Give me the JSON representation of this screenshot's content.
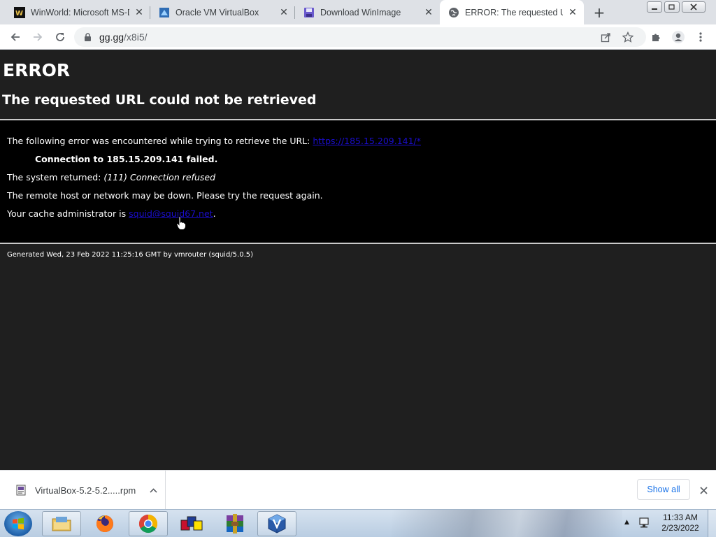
{
  "browser": {
    "tabs": [
      {
        "title": "WinWorld: Microsoft MS-D",
        "icon": "winworld-icon",
        "active": false
      },
      {
        "title": "Oracle VM VirtualBox",
        "icon": "virtualbox-icon",
        "active": false
      },
      {
        "title": "Download WinImage",
        "icon": "floppy-disk-icon",
        "active": false
      },
      {
        "title": "ERROR: The requested URL",
        "icon": "globe-icon",
        "active": true
      }
    ],
    "new_tab_label": "+",
    "address_bar": {
      "host": "gg.gg",
      "path": "/x8i5/"
    }
  },
  "page": {
    "heading": "ERROR",
    "subheading": "The requested URL could not be retrieved",
    "error_intro": "The following error was encountered while trying to retrieve the URL: ",
    "error_url": "https://185.15.209.141/*",
    "connection_failed": "Connection to 185.15.209.141 failed.",
    "system_returned_label": "The system returned: ",
    "system_returned_value": "(111) Connection refused",
    "remote_host_msg": "The remote host or network may be down. Please try the request again.",
    "cache_admin_label": "Your cache administrator is ",
    "cache_admin_email": "squid@squid67.net",
    "cache_admin_suffix": ".",
    "footer": "Generated Wed, 23 Feb 2022 11:25:16 GMT by vmrouter (squid/5.0.5)"
  },
  "downloads": {
    "item_name": "VirtualBox-5.2-5.2.....rpm",
    "show_all_label": "Show all"
  },
  "taskbar": {
    "pinned": [
      {
        "name": "explorer-icon"
      },
      {
        "name": "firefox-icon"
      },
      {
        "name": "chrome-icon"
      },
      {
        "name": "winimage-icon"
      },
      {
        "name": "winrar-icon"
      },
      {
        "name": "virtualbox-icon"
      }
    ],
    "clock_time": "11:33 AM",
    "clock_date": "2/23/2022"
  },
  "colors": {
    "page_background": "#1f1f1f",
    "error_box": "#000000",
    "link": "#1a0dcc",
    "accent": "#1a73e8"
  }
}
